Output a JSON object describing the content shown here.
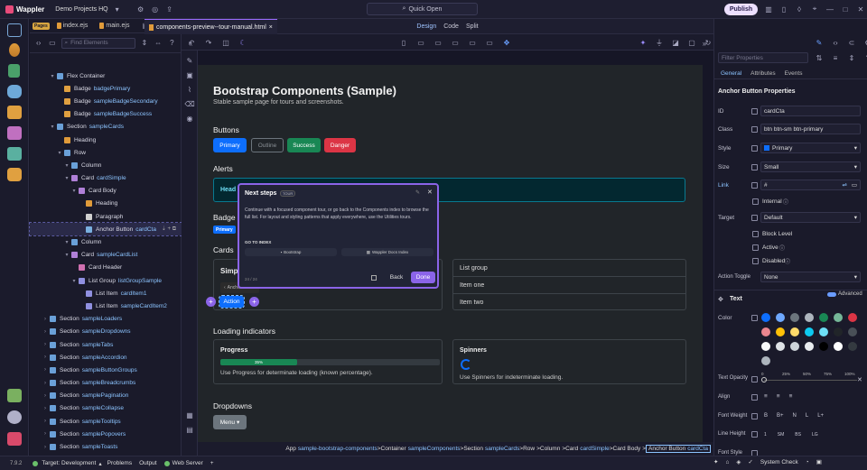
{
  "app": {
    "name": "Wappler",
    "project": "Demo Projects HQ",
    "quick_open": "Quick Open",
    "publish": "Publish"
  },
  "colors": {
    "accent": "#9b6bff",
    "primary": "#0d6efd",
    "success": "#198754",
    "danger": "#dc3545",
    "link": "#8cc4ff"
  },
  "tabs": {
    "pages_tag": "Pages",
    "files": [
      "index.ejs",
      "main.ejs",
      "components-preview--tour-manual.html"
    ],
    "close": "×"
  },
  "structure": {
    "find_placeholder": "Find Elements",
    "tree": [
      {
        "label": "Flex Container",
        "name": "",
        "icon": "flex-icon"
      },
      {
        "label": "Badge",
        "name": "badgePrimary",
        "icon": "badge-icon"
      },
      {
        "label": "Badge",
        "name": "sampleBadgeSecondary",
        "icon": "badge-icon"
      },
      {
        "label": "Badge",
        "name": "sampleBadgeSuccess",
        "icon": "badge-icon"
      },
      {
        "label": "Section",
        "name": "sampleCards",
        "icon": "section-icon"
      },
      {
        "label": "Heading",
        "name": "",
        "icon": "heading-icon"
      },
      {
        "label": "Row",
        "name": "",
        "icon": "row-icon"
      },
      {
        "label": "Column",
        "name": "",
        "icon": "column-icon"
      },
      {
        "label": "Card",
        "name": "cardSimple",
        "icon": "card-icon"
      },
      {
        "label": "Card Body",
        "name": "",
        "icon": "card-body-icon"
      },
      {
        "label": "Heading",
        "name": "",
        "icon": "heading-icon"
      },
      {
        "label": "Paragraph",
        "name": "",
        "icon": "paragraph-icon"
      },
      {
        "label": "Anchor Button",
        "name": "cardCta",
        "icon": "anchor-icon"
      },
      {
        "label": "Column",
        "name": "",
        "icon": "column-icon"
      },
      {
        "label": "Card",
        "name": "sampleCardList",
        "icon": "card-icon"
      },
      {
        "label": "Card Header",
        "name": "",
        "icon": "card-header-icon"
      },
      {
        "label": "List Group",
        "name": "listGroupSample",
        "icon": "list-icon"
      },
      {
        "label": "List Item",
        "name": "cardItem1",
        "icon": "list-item-icon"
      },
      {
        "label": "List Item",
        "name": "sampleCardItem2",
        "icon": "list-item-icon"
      },
      {
        "label": "Section",
        "name": "sampleLoaders",
        "icon": "section-icon"
      },
      {
        "label": "Section",
        "name": "sampleDropdowns",
        "icon": "section-icon"
      },
      {
        "label": "Section",
        "name": "sampleTabs",
        "icon": "section-icon"
      },
      {
        "label": "Section",
        "name": "sampleAccordion",
        "icon": "section-icon"
      },
      {
        "label": "Section",
        "name": "sampleButtonGroups",
        "icon": "section-icon"
      },
      {
        "label": "Section",
        "name": "sampleBreadcrumbs",
        "icon": "section-icon"
      },
      {
        "label": "Section",
        "name": "samplePagination",
        "icon": "section-icon"
      },
      {
        "label": "Section",
        "name": "sampleCollapse",
        "icon": "section-icon"
      },
      {
        "label": "Section",
        "name": "sampleTooltips",
        "icon": "section-icon"
      },
      {
        "label": "Section",
        "name": "samplePopovers",
        "icon": "section-icon"
      },
      {
        "label": "Section",
        "name": "sampleToasts",
        "icon": "section-icon"
      }
    ]
  },
  "editor": {
    "views": [
      "Design",
      "Code",
      "Split"
    ]
  },
  "canvas": {
    "title": "Bootstrap Components (Sample)",
    "subtitle": "Stable sample page for tours and screenshots.",
    "buttons_heading": "Buttons",
    "buttons": [
      "Primary",
      "Outline",
      "Success",
      "Danger"
    ],
    "alerts_heading": "Alerts",
    "alert_text": "Head",
    "badges_heading": "Badge",
    "badge_primary": "Primary",
    "cards_heading": "Cards",
    "card_simple_heading": "Simp",
    "anchor_tooltip": "Anchor Button",
    "action_button": "Action",
    "list_group": [
      "List group",
      "Item one",
      "Item two"
    ],
    "loading_heading": "Loading indicators",
    "progress_title": "Progress",
    "progress_value": 35,
    "progress_label": "35%",
    "progress_text": "Use Progress for determinate loading (known percentage).",
    "spinners_title": "Spinners",
    "spinners_text": "Use Spinners for indeterminate loading.",
    "dropdowns_heading": "Dropdowns",
    "menu_button": "Menu"
  },
  "tour": {
    "title": "Next steps",
    "tag": "TOUR",
    "body": "Continue with a focused component tour, or go back to the Components index to browse the full list. For layout and styling patterns that apply everywhere, use the Utilities tours.",
    "goto": "GO TO INDEX",
    "options": [
      "Bootstrap",
      "Wappler Docs Index"
    ],
    "counter": "24 / 24",
    "back": "Back",
    "done": "Done"
  },
  "breadcrumbs": [
    {
      "type": "App",
      "name": "sample-bootstrap-components"
    },
    {
      "type": "Container",
      "name": "sampleComponents"
    },
    {
      "type": "Section",
      "name": "sampleCards"
    },
    {
      "type": "Row",
      "name": ""
    },
    {
      "type": "Column",
      "name": ""
    },
    {
      "type": "Card",
      "name": "cardSimple"
    },
    {
      "type": "Card Body",
      "name": ""
    },
    {
      "type": "Anchor Button",
      "name": "cardCta"
    }
  ],
  "props": {
    "filter_placeholder": "Filter Properties",
    "tabs": [
      "General",
      "Attributes",
      "Events"
    ],
    "title": "Anchor Button Properties",
    "id_label": "ID",
    "id": "cardCta",
    "class_label": "Class",
    "class": "btn btn-sm btn-primary",
    "style_label": "Style",
    "style": "Primary",
    "size_label": "Size",
    "size": "Small",
    "link_label": "Link",
    "link": "#",
    "internal": "Internal",
    "target_label": "Target",
    "target": "Default",
    "block_level": "Block Level",
    "active": "Active",
    "disabled": "Disabled",
    "action_toggle_label": "Action Toggle",
    "action_toggle": "None",
    "text_section": "Text",
    "advanced": "Advanced",
    "color_label": "Color",
    "swatches": [
      "#0d6efd",
      "#6ea8fe",
      "#6c757d",
      "#adb5bd",
      "#198754",
      "#75b798",
      "#dc3545",
      "#ea868f",
      "#ffc107",
      "#ffda6a",
      "#0dcaf0",
      "#6edff6",
      "#212529",
      "#495057",
      "#f8f9fa",
      "#dee2e6",
      "#ced4da",
      "#e9ecef",
      "#000000",
      "#ffffff",
      "#343a40",
      "#adb5bd"
    ],
    "text_opacity_label": "Text Opacity",
    "opacity_ticks": [
      "0",
      "25%",
      "50%",
      "75%",
      "100%"
    ],
    "align_label": "Align",
    "font_weight_label": "Font Weight",
    "font_weights": [
      "B",
      "B+",
      "N",
      "L",
      "L+"
    ],
    "line_height_label": "Line Height",
    "line_heights": [
      "1",
      "SM",
      "BS",
      "LG"
    ],
    "font_style_label": "Font Style"
  },
  "status": {
    "version": "7.9.2",
    "target": "Target: Development",
    "problems": "Problems",
    "output": "Output",
    "web_server": "Web Server",
    "system_check": "System Check"
  }
}
